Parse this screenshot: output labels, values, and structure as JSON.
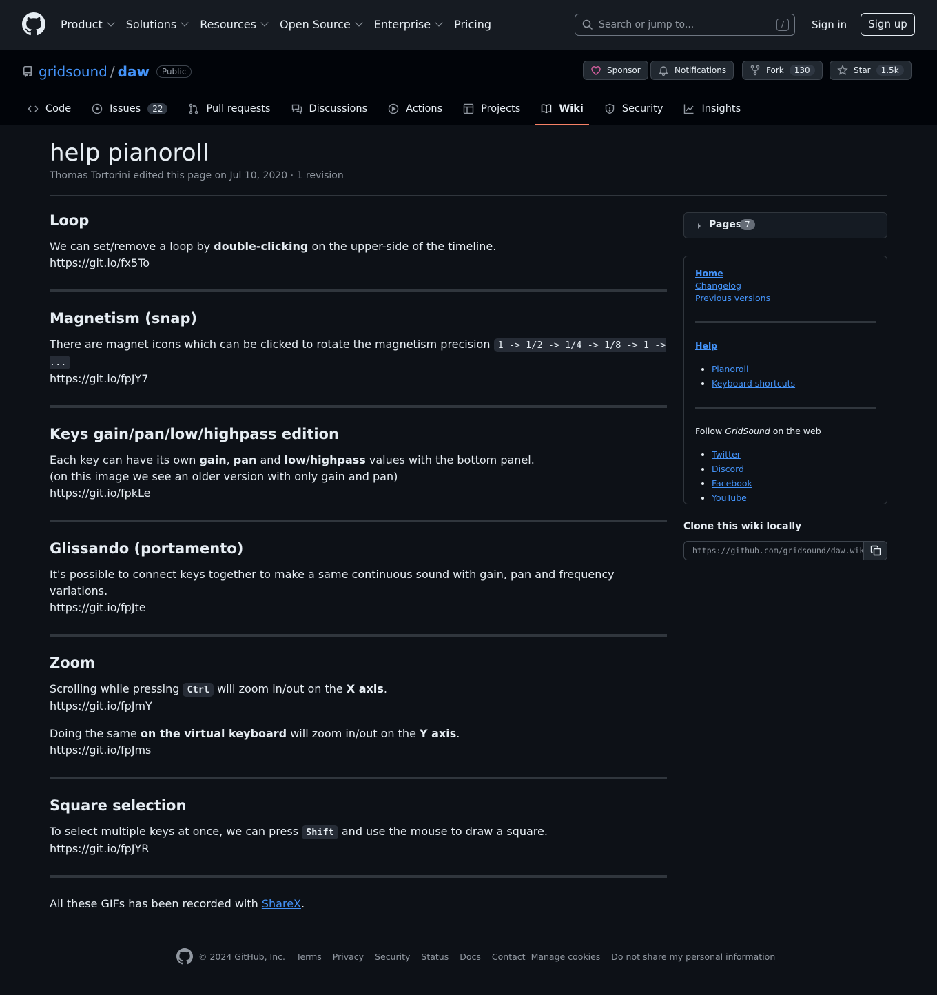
{
  "header": {
    "nav": [
      "Product",
      "Solutions",
      "Resources",
      "Open Source",
      "Enterprise",
      "Pricing"
    ],
    "search_placeholder": "Search or jump to...",
    "search_shortcut": "/",
    "signin": "Sign in",
    "signup": "Sign up"
  },
  "repo": {
    "owner": "gridsound",
    "separator": "/",
    "name": "daw",
    "visibility": "Public",
    "sponsor": "Sponsor",
    "notifications": "Notifications",
    "fork": "Fork",
    "fork_count": "130",
    "star": "Star",
    "star_count": "1.5k"
  },
  "tabs": [
    {
      "label": "Code"
    },
    {
      "label": "Issues",
      "count": "22"
    },
    {
      "label": "Pull requests"
    },
    {
      "label": "Discussions"
    },
    {
      "label": "Actions"
    },
    {
      "label": "Projects"
    },
    {
      "label": "Wiki"
    },
    {
      "label": "Security"
    },
    {
      "label": "Insights"
    }
  ],
  "page": {
    "title": "help pianoroll",
    "meta": "Thomas Tortorini edited this page on Jul 10, 2020 · 1 revision",
    "sections": {
      "loop": {
        "title": "Loop",
        "t1": "We can set/remove a loop by ",
        "b1": "double-clicking",
        "t2": " on the upper-side of the timeline.",
        "img": "https://git.io/fx5To"
      },
      "magnet": {
        "title": "Magnetism (snap)",
        "t1": "There are magnet icons which can be clicked to rotate the magnetism precision ",
        "code": "1 -> 1/2 -> 1/4 -> 1/8 -> 1 -> ...",
        "img": "https://git.io/fpJY7"
      },
      "keys": {
        "title": "Keys gain/pan/low/highpass edition",
        "t1": "Each key can have its own ",
        "b1": "gain",
        "t2": ", ",
        "b2": "pan",
        "t3": " and ",
        "b3": "low/highpass",
        "t4": " values with the bottom panel.",
        "line2": "(on this image we see an older version with only gain and pan)",
        "img": "https://git.io/fpkLe"
      },
      "gliss": {
        "title": "Glissando (portamento)",
        "t1": "It's possible to connect keys together to make a same continuous sound with gain, pan and frequency variations.",
        "img": "https://git.io/fpJte"
      },
      "zoom": {
        "title": "Zoom",
        "t1": "Scrolling while pressing ",
        "code": "Ctrl",
        "t2": " will zoom in/out on the ",
        "b1": "X axis",
        "t3": ".",
        "img1": "https://git.io/fpJmY",
        "t4": "Doing the same ",
        "b2": "on the virtual keyboard",
        "t5": " will zoom in/out on the ",
        "b3": "Y axis",
        "t6": ".",
        "img2": "https://git.io/fpJms"
      },
      "square": {
        "title": "Square selection",
        "t1": "To select multiple keys at once, we can press ",
        "code": "Shift",
        "t2": " and use the mouse to draw a square.",
        "img": "https://git.io/fpJYR"
      },
      "outro": {
        "t1": "All these GIFs has been recorded with ",
        "link": "ShareX",
        "t2": "."
      }
    }
  },
  "sidebar": {
    "pages_label": "Pages",
    "pages_count": "7",
    "links_top": [
      "Home",
      "Changelog",
      "Previous versions"
    ],
    "help_label": "Help",
    "help_links": [
      "Pianoroll",
      "Keyboard shortcuts"
    ],
    "follow_t1": "Follow ",
    "follow_em": "GridSound",
    "follow_t2": " on the web",
    "social": [
      "Twitter",
      "Discord",
      "Facebook",
      "YouTube"
    ],
    "clone_title": "Clone this wiki locally",
    "clone_url": "https://github.com/gridsound/daw.wiki.git"
  },
  "footer": {
    "copyright": "© 2024 GitHub, Inc.",
    "links": [
      "Terms",
      "Privacy",
      "Security",
      "Status",
      "Docs",
      "Contact",
      "Manage cookies",
      "Do not share my personal information"
    ]
  }
}
